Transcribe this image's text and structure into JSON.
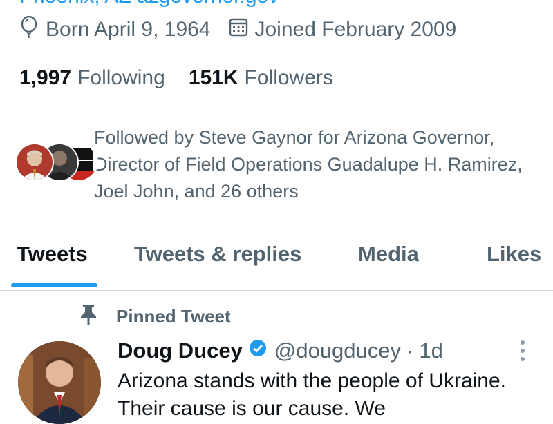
{
  "profile": {
    "top_clipped_text": "Phoenix, AZ  azgovernor.gov",
    "born": "Born April 9, 1964",
    "joined": "Joined February 2009",
    "following_count": "1,997",
    "following_label": "Following",
    "followers_count": "151K",
    "followers_label": "Followers",
    "followed_by": "Followed by Steve Gaynor for Arizona Governor, Director of Field Operations Guadalupe H. Ramirez, Joel John, and 26 others"
  },
  "tabs": [
    {
      "label": "Tweets",
      "active": true
    },
    {
      "label": "Tweets & replies",
      "active": false
    },
    {
      "label": "Media",
      "active": false
    },
    {
      "label": "Likes",
      "active": false
    }
  ],
  "tweet": {
    "pinned_label": "Pinned Tweet",
    "name": "Doug Ducey",
    "handle": "@dougducey",
    "separator": "·",
    "time": "1d",
    "text": "Arizona stands with the people of Ukraine. Their cause is our cause. We"
  },
  "icons": {
    "born": "balloon-icon",
    "joined": "calendar-icon",
    "pin": "pin-icon",
    "verified": "verified-badge-icon",
    "more": "more-vertical-icon"
  },
  "colors": {
    "accent": "#1d9bf0",
    "secondary_text": "#536471",
    "primary_text": "#0f1419",
    "divider": "#cfd9de"
  }
}
